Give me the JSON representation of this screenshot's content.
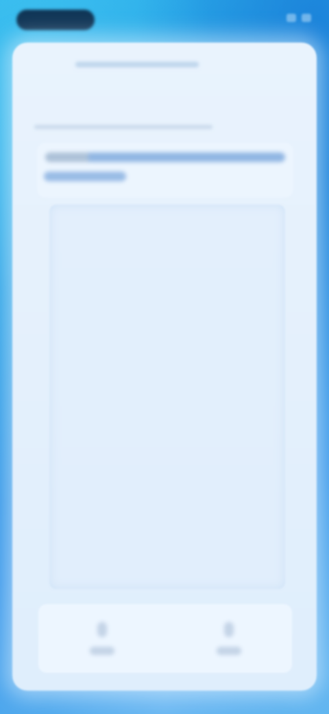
{
  "status_bar": {},
  "sheet": {
    "title": "",
    "subtitle": "",
    "info_text": ""
  },
  "bottom_bar": {
    "actions": [
      {
        "label": "",
        "icon": "action-icon"
      },
      {
        "label": "",
        "icon": "action-icon"
      }
    ]
  },
  "colors": {
    "background": "#1e8fe0",
    "sheet": "#e6f1fc",
    "accent": "#4682cd"
  }
}
